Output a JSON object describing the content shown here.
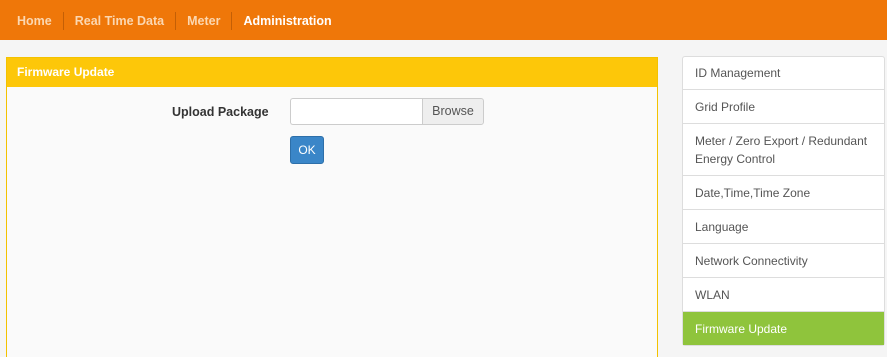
{
  "nav": {
    "items": [
      {
        "label": "Home"
      },
      {
        "label": "Real Time Data"
      },
      {
        "label": "Meter"
      },
      {
        "label": "Administration"
      }
    ],
    "active": "Administration"
  },
  "panel": {
    "title": "Firmware Update",
    "upload_label": "Upload Package",
    "file_value": "",
    "browse_label": "Browse",
    "ok_label": "OK"
  },
  "sidebar": {
    "items": [
      {
        "label": "ID Management"
      },
      {
        "label": "Grid Profile"
      },
      {
        "label": "Meter / Zero Export / Redundant Energy Control"
      },
      {
        "label": "Date,Time,Time Zone"
      },
      {
        "label": "Language"
      },
      {
        "label": "Network Connectivity"
      },
      {
        "label": "WLAN"
      },
      {
        "label": "Firmware Update"
      }
    ],
    "active": "Firmware Update"
  },
  "colors": {
    "topbar": "#ef7709",
    "panel_header": "#fdc709",
    "active_menu": "#8fc43c",
    "ok_button": "#3a86c8"
  }
}
